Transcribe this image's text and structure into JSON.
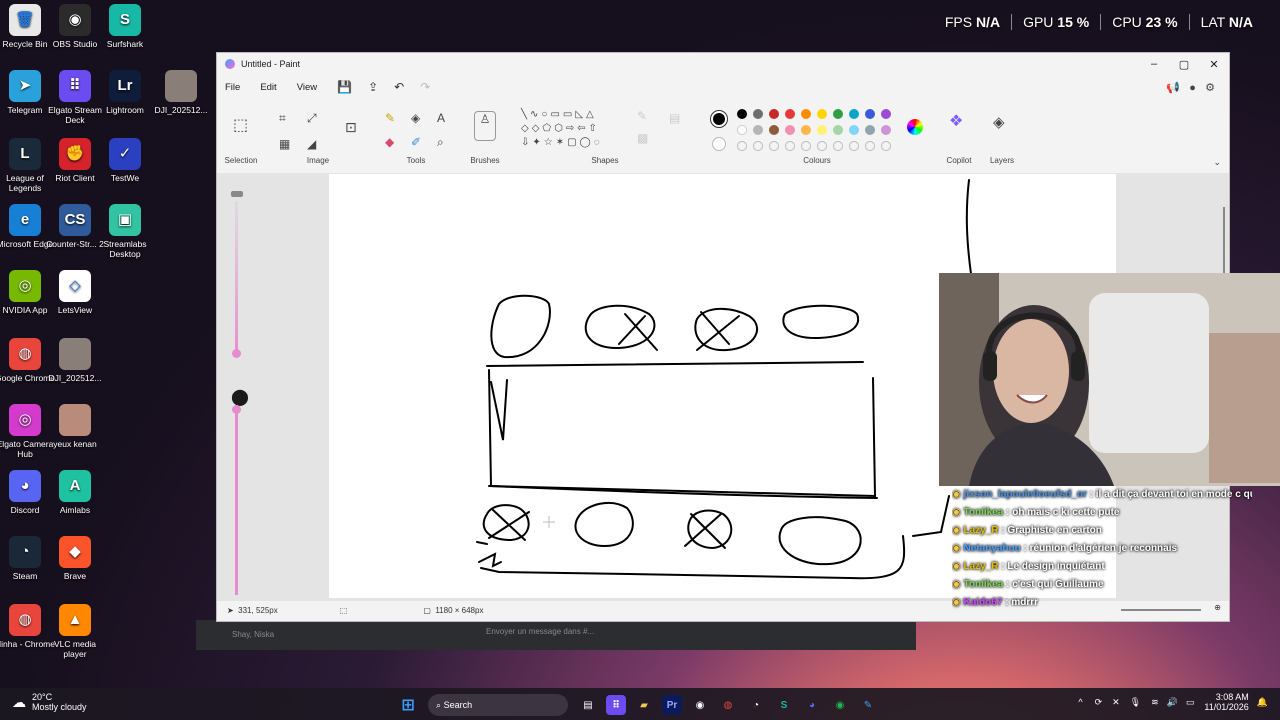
{
  "hud": {
    "fps_label": "FPS",
    "fps_value": "N/A",
    "gpu_label": "GPU",
    "gpu_value": "15 %",
    "cpu_label": "CPU",
    "cpu_value": "23 %",
    "lat_label": "LAT",
    "lat_value": "N/A"
  },
  "desktop_icons": [
    {
      "label": "Recycle Bin",
      "glyph": "🗑",
      "color": "#e8e8e8"
    },
    {
      "label": "OBS Studio",
      "glyph": "◉",
      "color": "#2b2b2b"
    },
    {
      "label": "Surfshark",
      "glyph": "S",
      "color": "#17b9a6"
    },
    {
      "label": "Telegram",
      "glyph": "➤",
      "color": "#2aa1da"
    },
    {
      "label": "Elgato Stream Deck",
      "glyph": "⠿",
      "color": "#6a4cf0"
    },
    {
      "label": "Lightroom",
      "glyph": "Lr",
      "color": "#0f1c3a"
    },
    {
      "label": "DJI_202512...",
      "glyph": "",
      "color": "#8a7f78"
    },
    {
      "label": "League of Legends",
      "glyph": "L",
      "color": "#1a2a3a"
    },
    {
      "label": "Riot Client",
      "glyph": "✊",
      "color": "#d4232b"
    },
    {
      "label": "TestWe",
      "glyph": "✓",
      "color": "#2a40c0"
    },
    {
      "label": "Microsoft Edge",
      "glyph": "e",
      "color": "#1780d4"
    },
    {
      "label": "Counter-Str... 2",
      "glyph": "CS",
      "color": "#2f5b9a"
    },
    {
      "label": "Streamlabs Desktop",
      "glyph": "▣",
      "color": "#31c3a2"
    },
    {
      "label": "NVIDIA App",
      "glyph": "◎",
      "color": "#76b900"
    },
    {
      "label": "LetsView",
      "glyph": "◇",
      "color": "#ffffff"
    },
    {
      "label": "Google Chrome",
      "glyph": "◍",
      "color": "#e8453c"
    },
    {
      "label": "DJI_202512...",
      "glyph": "",
      "color": "#8a7f78"
    },
    {
      "label": "Elgato Camera Hub",
      "glyph": "◎",
      "color": "#d43bcc"
    },
    {
      "label": "yeux kenan",
      "glyph": "",
      "color": "#b98b7a"
    },
    {
      "label": "Discord",
      "glyph": "◕",
      "color": "#5865f2"
    },
    {
      "label": "Aimlabs",
      "glyph": "A",
      "color": "#1fc2a0"
    },
    {
      "label": "Steam",
      "glyph": "◔",
      "color": "#1b2838"
    },
    {
      "label": "Brave",
      "glyph": "◆",
      "color": "#fb542b"
    },
    {
      "label": "Ninha - Chrome",
      "glyph": "◍",
      "color": "#e8453c"
    },
    {
      "label": "VLC media player",
      "glyph": "▲",
      "color": "#ff8800"
    }
  ],
  "paint": {
    "title": "Untitled - Paint",
    "menu": [
      "File",
      "Edit",
      "View"
    ],
    "groups": {
      "selection": "Selection",
      "image": "Image",
      "tools": "Tools",
      "brushes": "Brushes",
      "shapes": "Shapes",
      "colours": "Colours",
      "copilot": "Copilot",
      "layers": "Layers"
    },
    "palette": [
      "#000000",
      "#6e6e6e",
      "#c62828",
      "#e53935",
      "#ff8c00",
      "#ffd500",
      "#2ea043",
      "#0aa4c9",
      "#3a5bd9",
      "#9c4bd6",
      "#ffffff",
      "#b5b5b5",
      "#8d5a3c",
      "#f48fb1",
      "#ffb74d",
      "#fff176",
      "#a5d6a7",
      "#81d4fa",
      "#90a4ae",
      "#ce93d8"
    ],
    "status": {
      "cursor": "331, 525px",
      "canvas_size": "1180 × 648px"
    }
  },
  "chat": [
    {
      "user": "jixson_lapoule0oeufsd_or",
      "user_color": "#4a90e2",
      "msg": "il a dit ça devant toi en mode c qui elle mdrrr"
    },
    {
      "user": "Toniikea",
      "user_color": "#7ed957",
      "msg": "oh mais c ki cette pute"
    },
    {
      "user": "Lazy_R",
      "user_color": "#e0c000",
      "msg": "Graphiste en carton"
    },
    {
      "user": "Netanyahuu",
      "user_color": "#4aa0ff",
      "msg": "réunion d'algérien je reconnais"
    },
    {
      "user": "Lazy_R",
      "user_color": "#e0c000",
      "msg": "Le design inquiétant"
    },
    {
      "user": "Toniikea",
      "user_color": "#7ed957",
      "msg": "c'est qui Guillaume"
    },
    {
      "user": "Kaido67",
      "user_color": "#d04aff",
      "msg": "mdrrr"
    }
  ],
  "discord": {
    "names": "Shay, Niska",
    "placeholder": "Envoyer un message dans #..."
  },
  "taskbar": {
    "weather_temp": "20°C",
    "weather_desc": "Mostly cloudy",
    "search_placeholder": "Search",
    "time": "3:08 AM",
    "date": "11/01/2026"
  }
}
